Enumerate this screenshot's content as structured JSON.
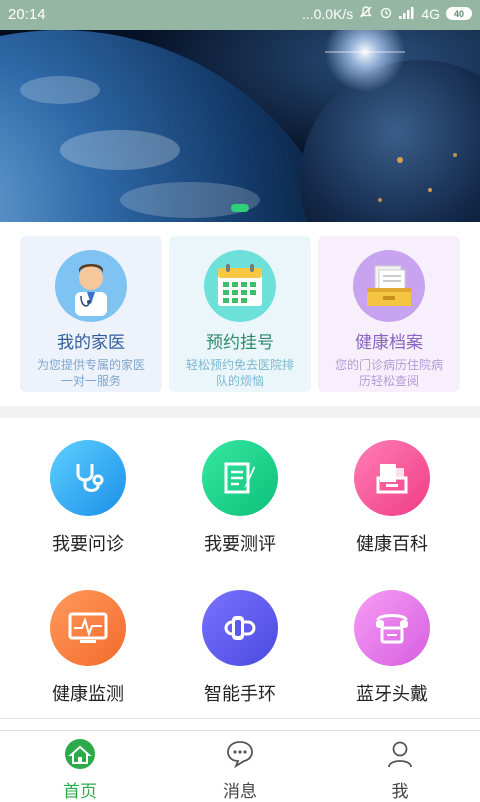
{
  "status_bar": {
    "time": "20:14",
    "network_speed": "...0.0K/s",
    "signal": "4G",
    "battery": "40"
  },
  "banner": {
    "image": "earth-from-space",
    "indicator_count": 1
  },
  "feature_cards": [
    {
      "title": "我的家医",
      "desc": "为您提供专属的家医一对一服务",
      "icon": "doctor-icon"
    },
    {
      "title": "预约挂号",
      "desc": "轻松预约免去医院排队的烦恼",
      "icon": "calendar-icon"
    },
    {
      "title": "健康档案",
      "desc": "您的门诊病历住院病历轻松查阅",
      "icon": "file-box-icon"
    }
  ],
  "services": [
    {
      "label": "我要问诊",
      "icon": "stethoscope-icon"
    },
    {
      "label": "我要测评",
      "icon": "assessment-icon"
    },
    {
      "label": "健康百科",
      "icon": "encyclopedia-icon"
    },
    {
      "label": "健康监测",
      "icon": "monitor-icon"
    },
    {
      "label": "智能手环",
      "icon": "wristband-icon"
    },
    {
      "label": "蓝牙头戴",
      "icon": "headset-icon"
    }
  ],
  "tabbar": {
    "home": "首页",
    "messages": "消息",
    "me": "我",
    "active": "home"
  },
  "colors": {
    "accent": "#2caa4a",
    "status_bar": "#96b6a4"
  }
}
